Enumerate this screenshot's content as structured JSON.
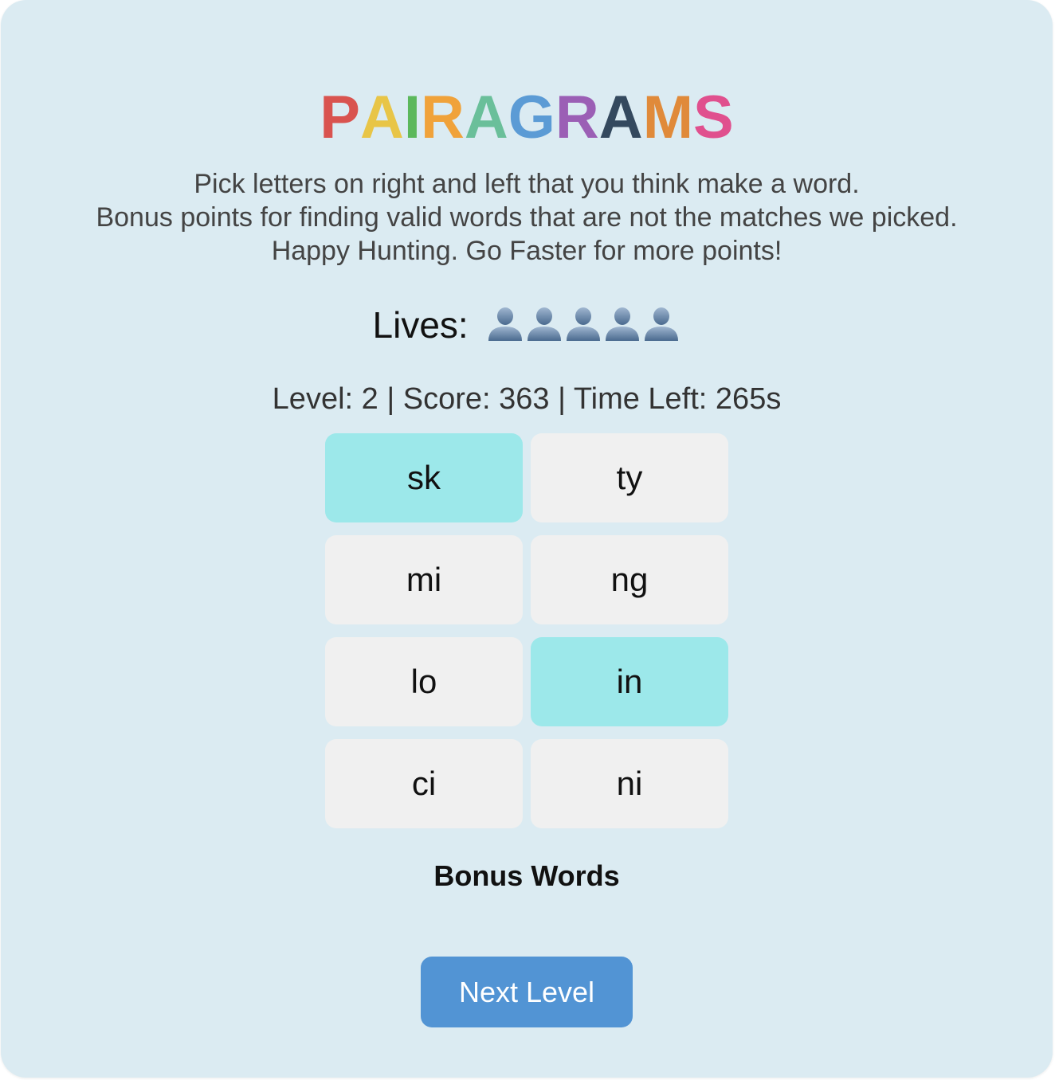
{
  "game": {
    "title_letters": [
      {
        "char": "P",
        "color": "#d9534f"
      },
      {
        "char": "A",
        "color": "#e8c547"
      },
      {
        "char": "I",
        "color": "#5cb85c"
      },
      {
        "char": "R",
        "color": "#f0a23a"
      },
      {
        "char": "A",
        "color": "#6abf9a"
      },
      {
        "char": "G",
        "color": "#5b9bd5"
      },
      {
        "char": "R",
        "color": "#9b5fb5"
      },
      {
        "char": "A",
        "color": "#34495e"
      },
      {
        "char": "M",
        "color": "#e08a3a"
      },
      {
        "char": "S",
        "color": "#e0508e"
      }
    ]
  },
  "instructions": [
    "Pick letters on right and left that you think make a word.",
    "Bonus points for finding valid words that are not the matches we picked.",
    "Happy Hunting. Go Faster for more points!"
  ],
  "lives": {
    "label": "Lives:",
    "count": 5,
    "icon": "bust-in-silhouette-icon"
  },
  "status": {
    "text": "Level: 2 | Score: 363 | Time Left: 265s"
  },
  "tiles": [
    {
      "text": "sk",
      "selected": true
    },
    {
      "text": "ty",
      "selected": false
    },
    {
      "text": "mi",
      "selected": false
    },
    {
      "text": "ng",
      "selected": false
    },
    {
      "text": "lo",
      "selected": false
    },
    {
      "text": "in",
      "selected": true
    },
    {
      "text": "ci",
      "selected": false
    },
    {
      "text": "ni",
      "selected": false
    }
  ],
  "bonus": {
    "heading": "Bonus Words"
  },
  "next_button": {
    "label": "Next Level"
  },
  "colors": {
    "background": "#dbebf2",
    "tile": "#f0f0f0",
    "tile_selected": "#9ce8ea",
    "button": "#5294d4"
  }
}
